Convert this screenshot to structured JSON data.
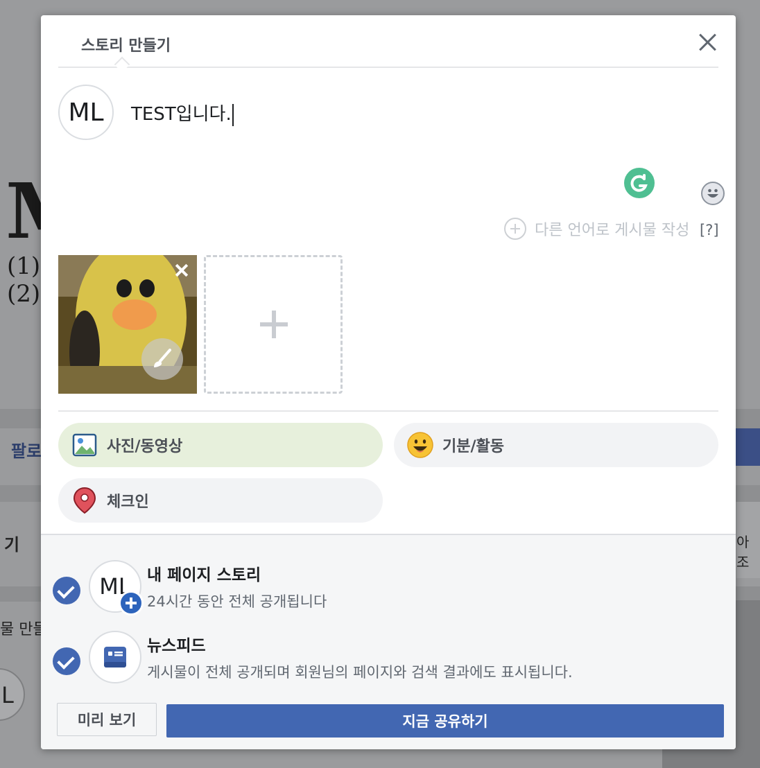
{
  "background": {
    "big_letter": "M",
    "list_1": "(1)",
    "list_2": "(2)",
    "follow_fragment": "팔로",
    "left_fragment_1": "기",
    "left_fragment_2": "물 만들",
    "right_fragment": "아조",
    "avatar_fragment": "L"
  },
  "dialog": {
    "tab_title": "스토리 만들기",
    "avatar_initials": "ML",
    "composer_text": "TEST입니다.",
    "other_language_label": "다른 언어로 게시물 작성",
    "help_label": "[?]",
    "actions": {
      "photo_video": "사진/동영상",
      "feeling_activity": "기분/활동",
      "check_in": "체크인"
    },
    "destinations": [
      {
        "title": "내 페이지 스토리",
        "description": "24시간 동안 전체 공개됩니다",
        "avatar_initials": "ML"
      },
      {
        "title": "뉴스피드",
        "description": "게시물이 전체 공개되며 회원님의 페이지와 검색 결과에도 표시됩니다."
      }
    ],
    "preview_label": "미리 보기",
    "share_label": "지금 공유하기"
  },
  "icons": {
    "close": "close-icon",
    "grammarly": "grammarly-icon",
    "emoji": "smiley-icon",
    "photo": "photo-icon",
    "feeling": "smiley-face-icon",
    "checkin": "location-pin-icon",
    "newsfeed": "newsfeed-icon"
  },
  "colors": {
    "primary": "#4267b2",
    "photo_pill": "#e7f0dc",
    "grammarly": "#4fbf92"
  }
}
